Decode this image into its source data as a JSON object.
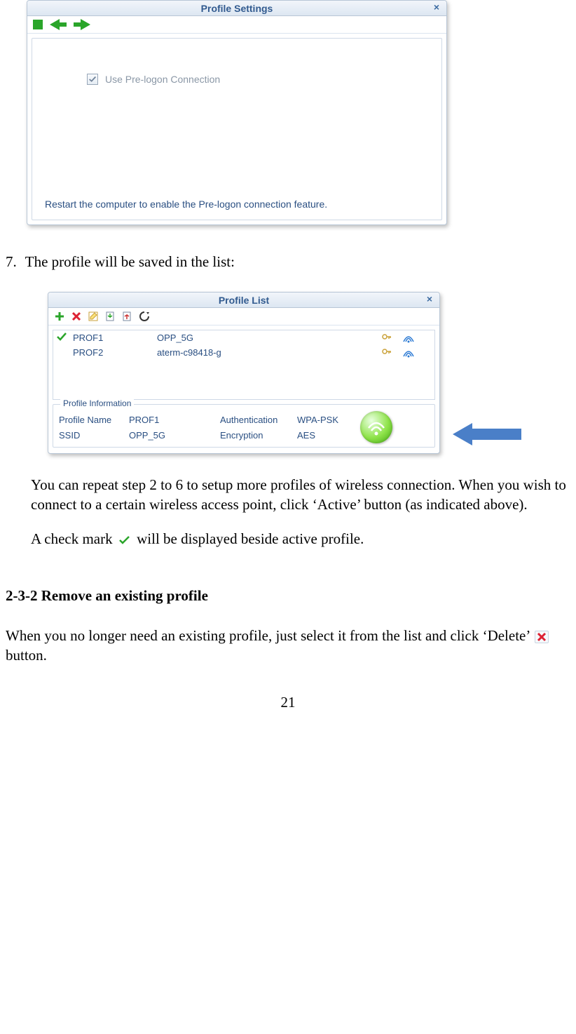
{
  "settings_window": {
    "title": "Profile Settings",
    "checkbox_label": "Use Pre-logon Connection",
    "note": "Restart the computer to enable the Pre-logon connection feature."
  },
  "step7": {
    "number": "7.",
    "text": "The profile will be saved in the list:"
  },
  "list_window": {
    "title": "Profile List",
    "rows": [
      {
        "active": true,
        "name": "PROF1",
        "ssid": "OPP_5G"
      },
      {
        "active": false,
        "name": "PROF2",
        "ssid": "aterm-c98418-g"
      }
    ],
    "info": {
      "legend": "Profile Information",
      "labels": {
        "profile_name": "Profile Name",
        "ssid": "SSID",
        "auth": "Authentication",
        "enc": "Encryption"
      },
      "values": {
        "profile_name": "PROF1",
        "ssid": "OPP_5G",
        "auth": "WPA-PSK",
        "enc": "AES"
      }
    }
  },
  "body": {
    "p1": "You can repeat step 2 to 6 to setup more profiles of wireless connection. When you wish to connect to a certain wireless access point, click ‘Active’ button (as indicated above).",
    "p2a": "A check mark ",
    "p2b": " will be displayed beside active profile.",
    "section": "2-3-2 Remove an existing profile",
    "p3a": "When you no longer need an existing profile, just select it from the list and click ‘Delete’ ",
    "p3b": " button."
  },
  "page_number": "21"
}
